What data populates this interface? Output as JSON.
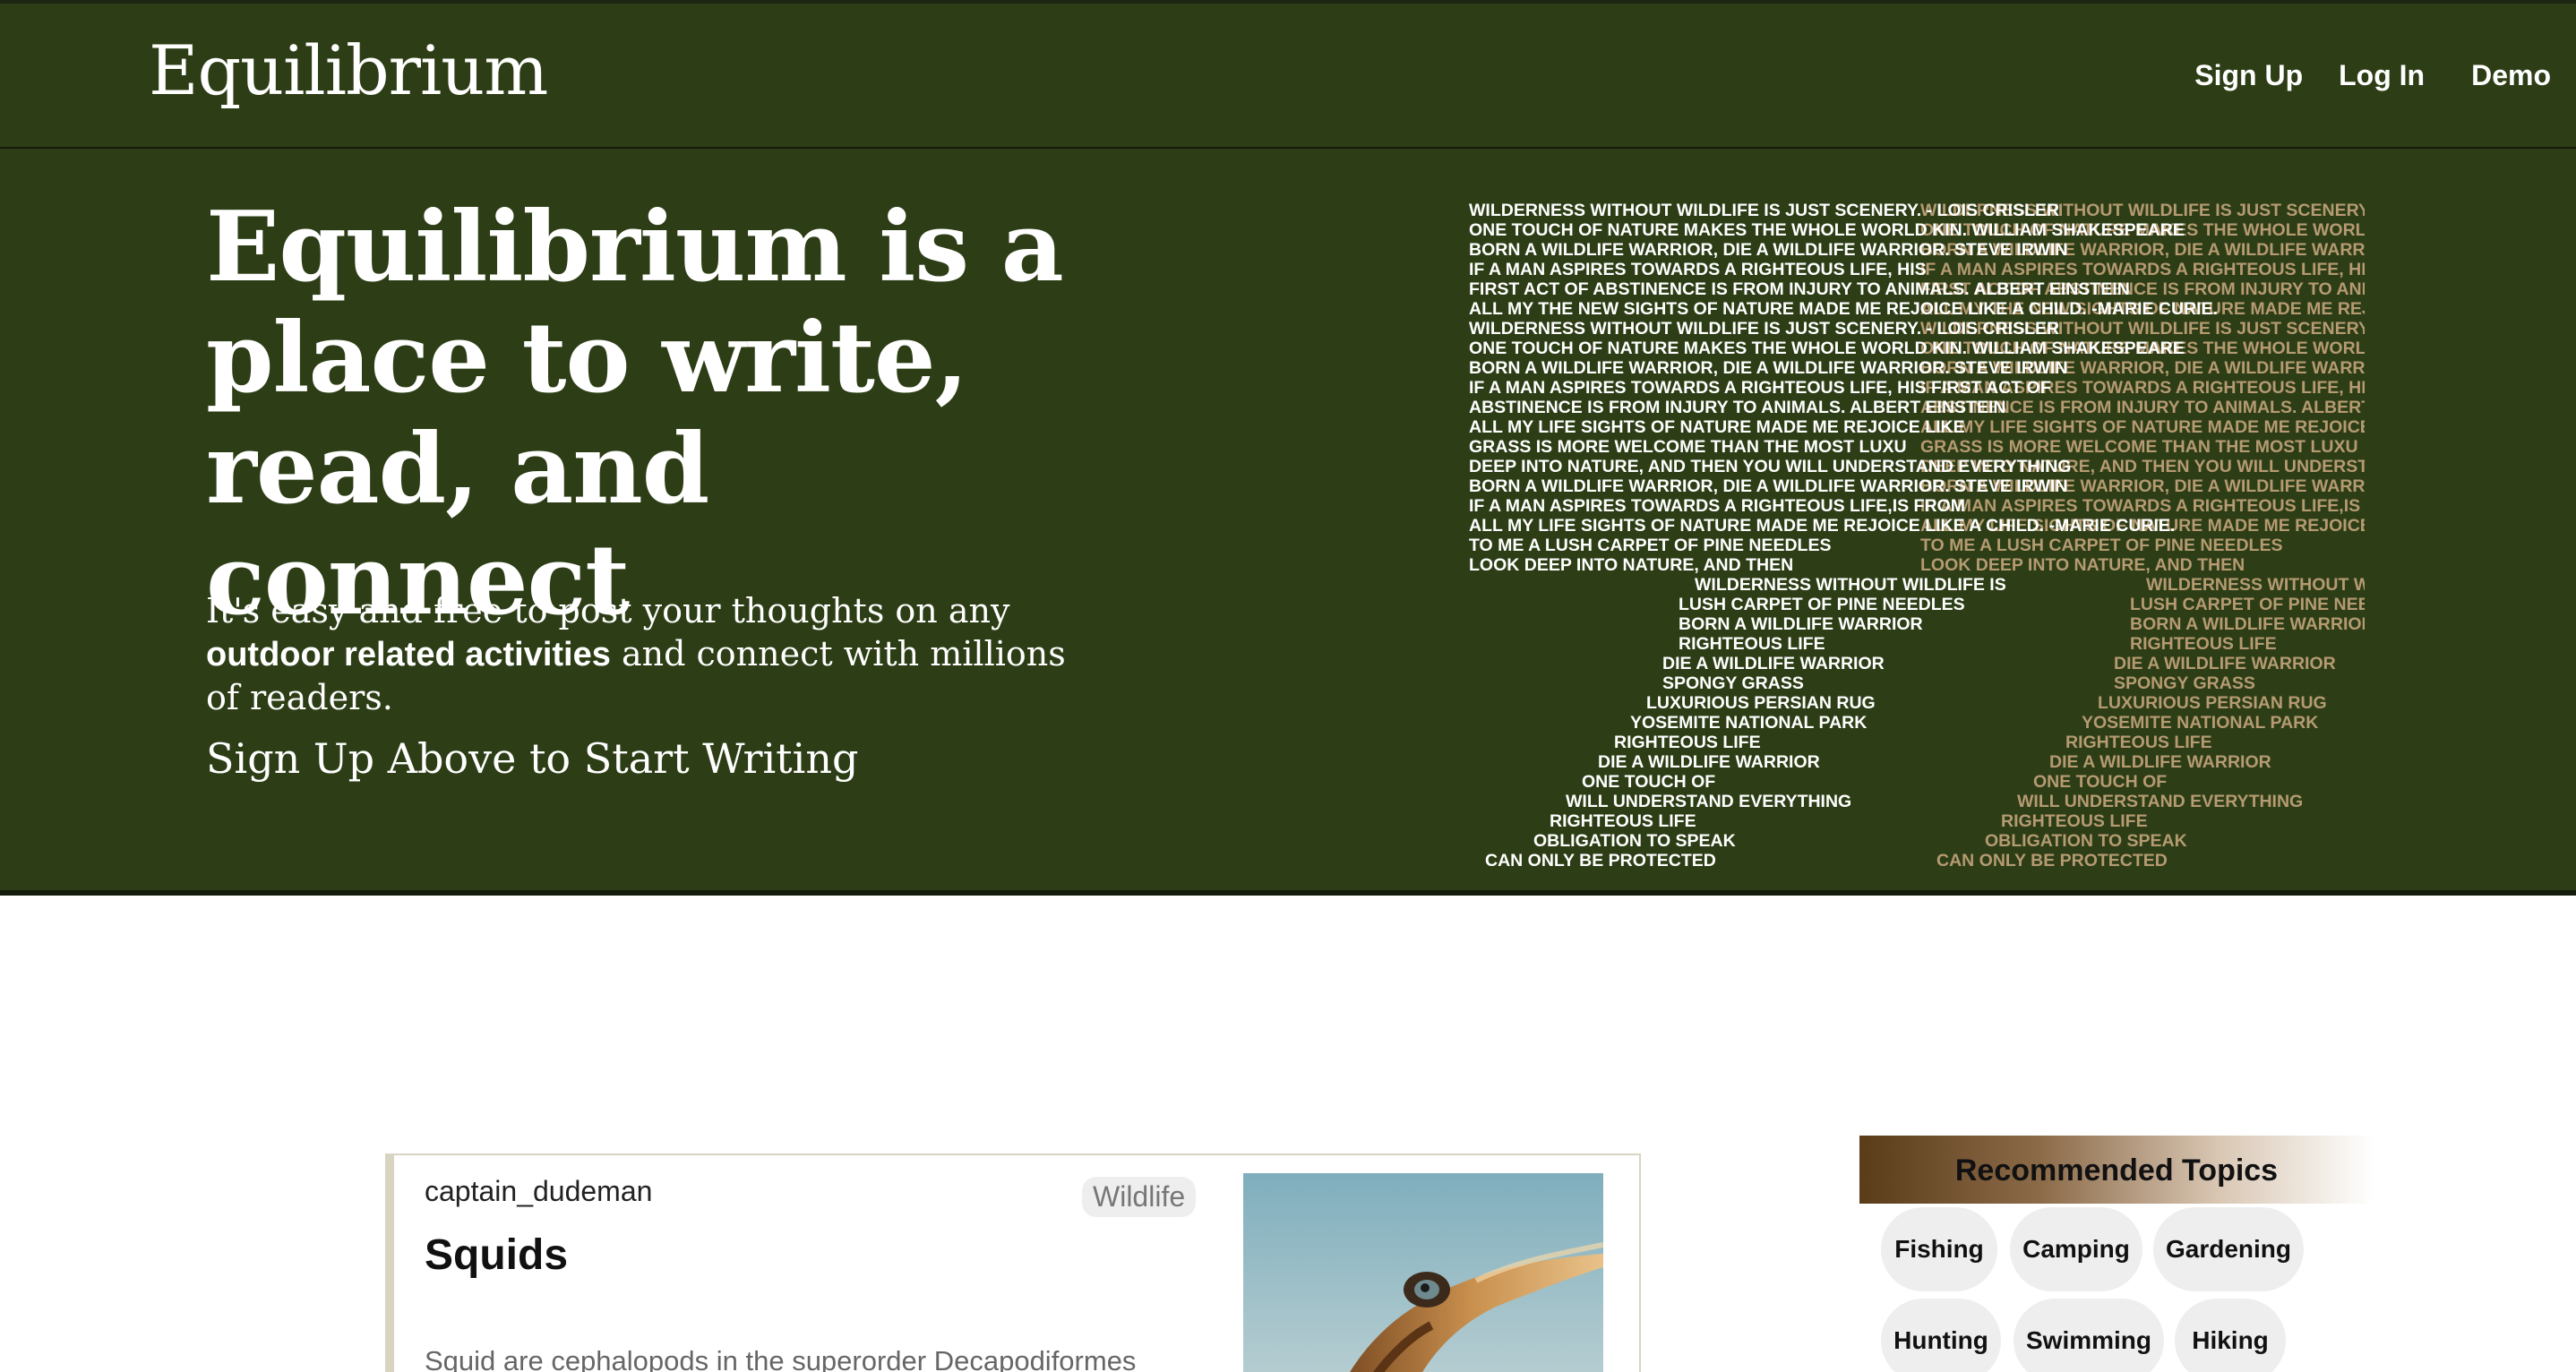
{
  "nav": {
    "brand": "Equilibrium",
    "signup_label": "Sign Up",
    "login_label": "Log In",
    "demo_label": "Demo"
  },
  "hero": {
    "title": "Equilibrium is a place to write, read, and connect",
    "subtitle_prefix": "It's easy and free to post your thoughts on any ",
    "subtitle_bold": "outdoor related activities",
    "subtitle_suffix": " and connect with millions of readers.",
    "cta": "Sign Up Above to Start Writing"
  },
  "quote_art": {
    "lines_white": [
      "WILDERNESS WITHOUT WILDLIFE IS JUST SCENERY. - LOIS CRISLER",
      "ONE TOUCH OF NATURE MAKES THE WHOLE WORLD KIN. WILLIAM SHAKESPEARE",
      "BORN A WILDLIFE WARRIOR, DIE A WILDLIFE WARRIOR. STEVE IRWIN",
      "IF A MAN ASPIRES TOWARDS A RIGHTEOUS LIFE, HIS",
      "FIRST ACT OF ABSTINENCE IS FROM INJURY TO ANIMALS. ALBERT EINSTEIN",
      "ALL MY THE NEW SIGHTS OF NATURE MADE ME REJOICE LIKE A CHILD. -MARIE CURIE.",
      "WILDERNESS WITHOUT WILDLIFE IS JUST SCENERY. - LOIS CRISLER",
      "ONE TOUCH OF NATURE MAKES THE WHOLE WORLD KIN. WILLIAM SHAKESPEARE",
      "BORN A WILDLIFE WARRIOR, DIE A WILDLIFE WARRIOR. STEVE IRWIN",
      "IF A MAN ASPIRES TOWARDS A RIGHTEOUS LIFE, HIS FIRST ACT OF",
      "ABSTINENCE IS FROM INJURY TO ANIMALS. ALBERT EINSTEIN",
      "ALL MY LIFE SIGHTS OF NATURE MADE ME REJOICE LIKE",
      "GRASS IS MORE WELCOME THAN THE MOST LUXU",
      "DEEP INTO NATURE, AND THEN YOU WILL UNDERSTAND EVERYTHING",
      "BORN A WILDLIFE WARRIOR, DIE A WILDLIFE WARRIOR. STEVE IRWIN",
      "IF A MAN ASPIRES TOWARDS A RIGHTEOUS LIFE,IS FROM",
      "ALL MY LIFE SIGHTS OF NATURE MADE ME REJOICE LIKE A CHILD. -MARIE CURIE.",
      "TO ME A LUSH CARPET OF PINE NEEDLES",
      "LOOK DEEP INTO NATURE, AND THEN",
      "WILDERNESS WITHOUT WILDLIFE IS",
      "LUSH CARPET OF PINE NEEDLES",
      "BORN A WILDLIFE WARRIOR",
      "RIGHTEOUS LIFE",
      "DIE A WILDLIFE WARRIOR",
      "SPONGY GRASS",
      "LUXURIOUS PERSIAN RUG",
      "YOSEMITE NATIONAL PARK",
      "RIGHTEOUS LIFE",
      "DIE A WILDLIFE WARRIOR",
      "ONE TOUCH OF",
      "WILL UNDERSTAND EVERYTHING",
      "RIGHTEOUS LIFE",
      "OBLIGATION TO SPEAK",
      "CAN ONLY BE PROTECTED"
    ]
  },
  "post": {
    "author": "captain_dudeman",
    "tag": "Wildlife",
    "title": "Squids",
    "excerpt": "Squid are cephalopods in the superorder Decapodiformes"
  },
  "topics": {
    "title": "Recommended Topics",
    "items": [
      "Fishing",
      "Camping",
      "Gardening",
      "Hunting",
      "Swimming",
      "Hiking"
    ]
  }
}
